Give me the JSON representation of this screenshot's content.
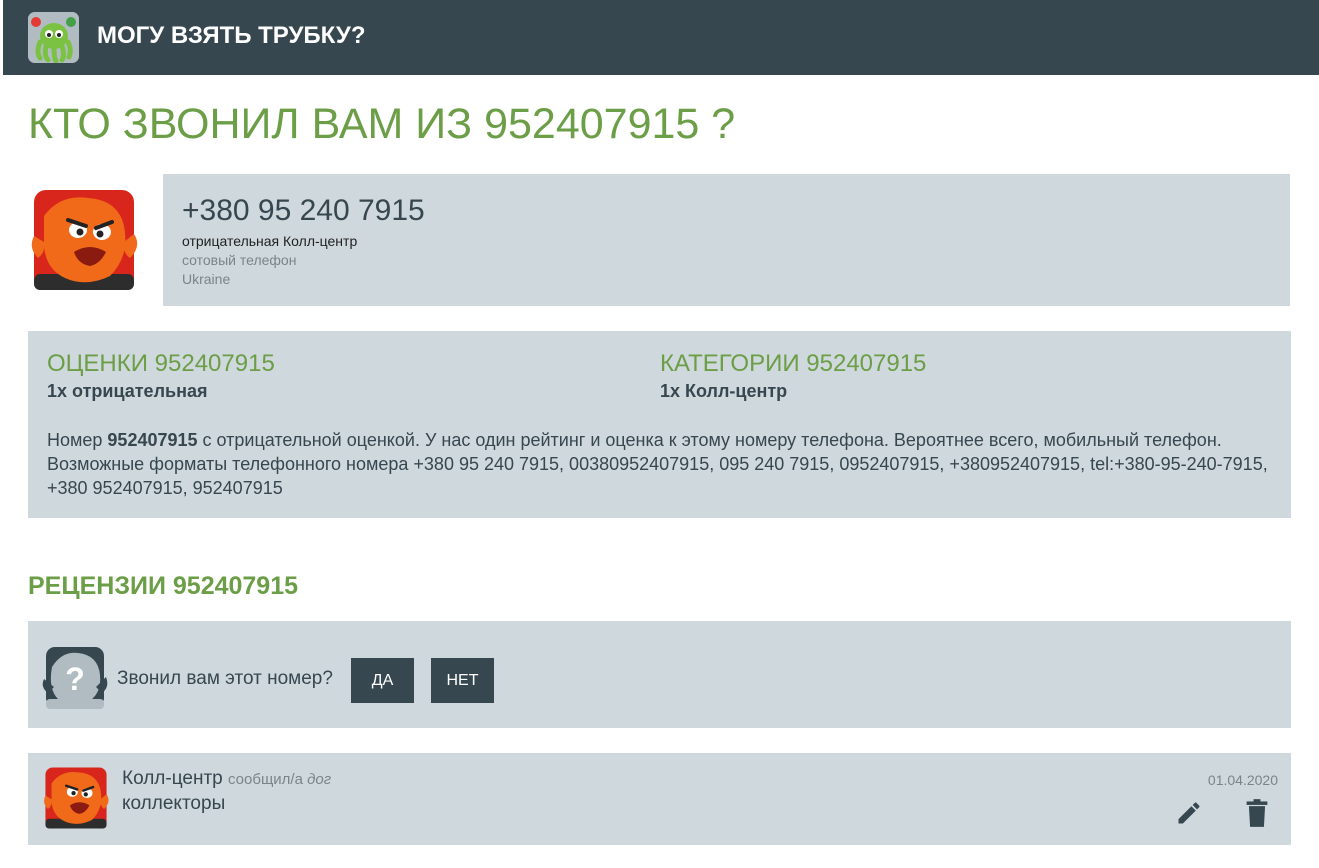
{
  "header": {
    "site_title": "МОГУ ВЗЯТЬ ТРУБКУ?",
    "logo_icon": "octopus-phone-logo-icon"
  },
  "page_title": "КТО ЗВОНИЛ ВАМ ИЗ 952407915 ?",
  "phone_card": {
    "avatar_icon": "angry-face-avatar-icon",
    "number": "+380 95 240 7915",
    "rating_category": "отрицательная Колл-центр",
    "line_type": "сотовый телефон",
    "country": "Ukraine"
  },
  "summary": {
    "ratings_heading": "ОЦЕНКИ 952407915",
    "ratings_value": "1x отрицательная",
    "categories_heading": "КАТЕГОРИИ 952407915",
    "categories_value": "1x Колл-центр",
    "desc_prefix": "Номер ",
    "desc_number": "952407915",
    "desc_body": " с отрицательной оценкой. У нас один рейтинг и оценка к этому номеру телефона. Вероятнее всего, мобильный телефон. Возможные форматы телефонного номера +380 95 240 7915, 00380952407915, 095 240 7915, 0952407915, +380952407915, tel:+380-95-240-7915, +380 952407915, 952407915"
  },
  "reviews": {
    "heading": "РЕЦЕНЗИИ 952407915",
    "question_icon": "question-mark-avatar-icon",
    "question": "Звонил вам этот номер?",
    "yes_label": "ДА",
    "no_label": "НЕТ",
    "items": [
      {
        "category": "Колл-центр",
        "reported_by_label": "сообщил/а",
        "author": "дог",
        "text": "коллекторы",
        "date": "01.04.2020",
        "edit_icon": "pencil-icon",
        "delete_icon": "trash-icon"
      }
    ]
  },
  "colors": {
    "header_bg": "#37474f",
    "accent_green": "#6b9e46",
    "panel_bg": "#cfd8dc",
    "button_bg": "#37474f",
    "avatar_orange": "#f06a1a",
    "avatar_red": "#d9261c"
  }
}
